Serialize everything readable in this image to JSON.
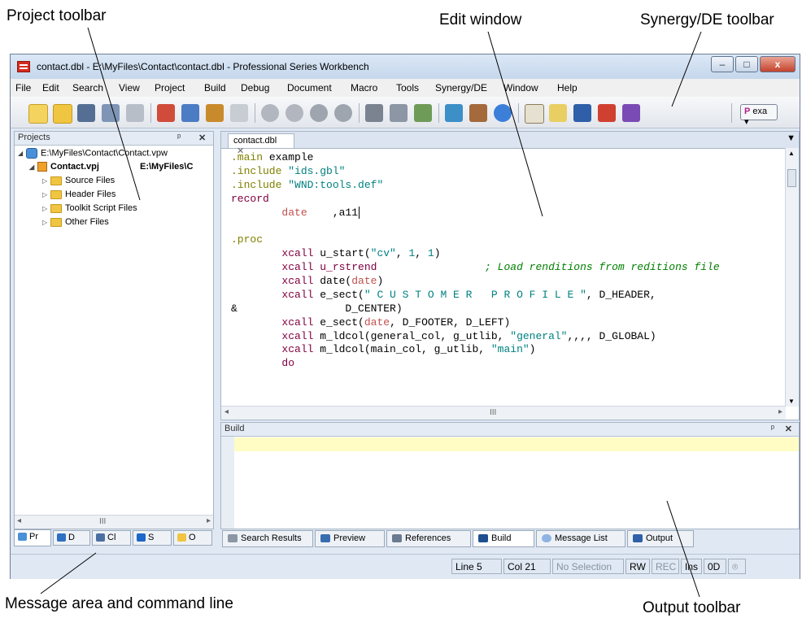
{
  "callouts": {
    "project_toolbar": "Project toolbar",
    "edit_window": "Edit window",
    "synergy_toolbar": "Synergy/DE toolbar",
    "message_area": "Message area and command line",
    "output_toolbar": "Output toolbar"
  },
  "window": {
    "title": "contact.dbl - E:\\MyFiles\\Contact\\contact.dbl - Professional Series Workbench",
    "buttons": {
      "minimize": "–",
      "maximize": "□",
      "close": "x"
    }
  },
  "menu": [
    "File",
    "Edit",
    "Search",
    "View",
    "Project",
    "Build",
    "Debug",
    "Document",
    "Macro",
    "Tools",
    "Synergy/DE",
    "Window",
    "Help"
  ],
  "toolbar": {
    "icons": [
      "new-file-icon",
      "open-folder-icon",
      "save-icon",
      "save-all-icon",
      "print-icon",
      "cut-icon",
      "copy-icon",
      "paste-icon",
      "select-icon",
      "undo-icon",
      "redo-icon",
      "back-icon",
      "forward-icon",
      "find-icon",
      "find-in-files-icon",
      "replace-icon",
      "build-icon",
      "tools-icon",
      "help-icon",
      "synergy-1-icon",
      "synergy-2-icon",
      "synergy-3-icon",
      "synergy-4-icon",
      "synergy-5-icon"
    ],
    "dropdown_label": "exa"
  },
  "projects": {
    "header": "Projects",
    "pin": "ᵖ",
    "close": "✕",
    "workspace": "E:\\MyFiles\\Contact\\Contact.vpw",
    "project": "Contact.vpj",
    "project_path": "E:\\MyFiles\\C",
    "folders": [
      "Source Files",
      "Header Files",
      "Toolkit Script Files",
      "Other Files"
    ],
    "tabs": [
      "Pr",
      "D",
      "Cl",
      "S",
      "O"
    ]
  },
  "editor": {
    "tab_label": "contact.dbl",
    "tab_close": "✕",
    "code": [
      {
        "segs": [
          {
            "t": ".main",
            "c": "#808000"
          },
          {
            "t": " example",
            "c": "#000000"
          }
        ]
      },
      {
        "segs": [
          {
            "t": ".include",
            "c": "#808000"
          },
          {
            "t": " \"ids.gbl\"",
            "c": "#008080"
          }
        ]
      },
      {
        "segs": [
          {
            "t": ".include",
            "c": "#808000"
          },
          {
            "t": " \"WND:tools.def\"",
            "c": "#008080"
          }
        ]
      },
      {
        "segs": [
          {
            "t": "record",
            "c": "#800040"
          }
        ]
      },
      {
        "segs": [
          {
            "t": "        date",
            "c": "#c0504d"
          },
          {
            "t": "    ,a11",
            "c": "#000000"
          }
        ]
      },
      {
        "segs": [
          {
            "t": "",
            "c": "#000000"
          }
        ]
      },
      {
        "segs": [
          {
            "t": ".proc",
            "c": "#808000"
          }
        ]
      },
      {
        "segs": [
          {
            "t": "        xcall",
            "c": "#800040"
          },
          {
            "t": " u_start(",
            "c": "#000000"
          },
          {
            "t": "\"cv\"",
            "c": "#008080"
          },
          {
            "t": ", ",
            "c": "#000000"
          },
          {
            "t": "1",
            "c": "#008080"
          },
          {
            "t": ", ",
            "c": "#000000"
          },
          {
            "t": "1",
            "c": "#008080"
          },
          {
            "t": ")",
            "c": "#000000"
          }
        ]
      },
      {
        "segs": [
          {
            "t": "        xcall",
            "c": "#800040"
          },
          {
            "t": " u_rstrend",
            "c": "#800040"
          },
          {
            "t": "                 ; Load renditions from reditions file",
            "c": "#008000",
            "i": true
          }
        ]
      },
      {
        "segs": [
          {
            "t": "        xcall",
            "c": "#800040"
          },
          {
            "t": " date(",
            "c": "#000000"
          },
          {
            "t": "date",
            "c": "#c0504d"
          },
          {
            "t": ")",
            "c": "#000000"
          }
        ]
      },
      {
        "segs": [
          {
            "t": "        xcall",
            "c": "#800040"
          },
          {
            "t": " e_sect(",
            "c": "#000000"
          },
          {
            "t": "\" C U S T O M E R   P R O F I L E \"",
            "c": "#008080"
          },
          {
            "t": ", D_HEADER,",
            "c": "#000000"
          }
        ]
      },
      {
        "segs": [
          {
            "t": "&                 D_CENTER)",
            "c": "#000000"
          }
        ]
      },
      {
        "segs": [
          {
            "t": "        xcall",
            "c": "#800040"
          },
          {
            "t": " e_sect(",
            "c": "#000000"
          },
          {
            "t": "date",
            "c": "#c0504d"
          },
          {
            "t": ", D_FOOTER, D_LEFT)",
            "c": "#000000"
          }
        ]
      },
      {
        "segs": [
          {
            "t": "        xcall",
            "c": "#800040"
          },
          {
            "t": " m_ldcol(general_col, g_utlib, ",
            "c": "#000000"
          },
          {
            "t": "\"general\"",
            "c": "#008080"
          },
          {
            "t": ",,,, D_GLOBAL)",
            "c": "#000000"
          }
        ]
      },
      {
        "segs": [
          {
            "t": "        xcall",
            "c": "#800040"
          },
          {
            "t": " m_ldcol(main_col, g_utlib, ",
            "c": "#000000"
          },
          {
            "t": "\"main\"",
            "c": "#008080"
          },
          {
            "t": ")",
            "c": "#000000"
          }
        ]
      },
      {
        "segs": [
          {
            "t": "        do",
            "c": "#800040"
          }
        ]
      }
    ],
    "scroll_grip": "III"
  },
  "build": {
    "header": "Build",
    "pin": "ᵖ",
    "close": "✕"
  },
  "output_tabs": [
    "Search Results",
    "Preview",
    "References",
    "Build",
    "Message List",
    "Output"
  ],
  "status": {
    "line": "Line 5",
    "col": "Col 21",
    "selection": "No Selection",
    "rw": "RW",
    "rec": "REC",
    "ins": "Ins",
    "code": "0D"
  }
}
